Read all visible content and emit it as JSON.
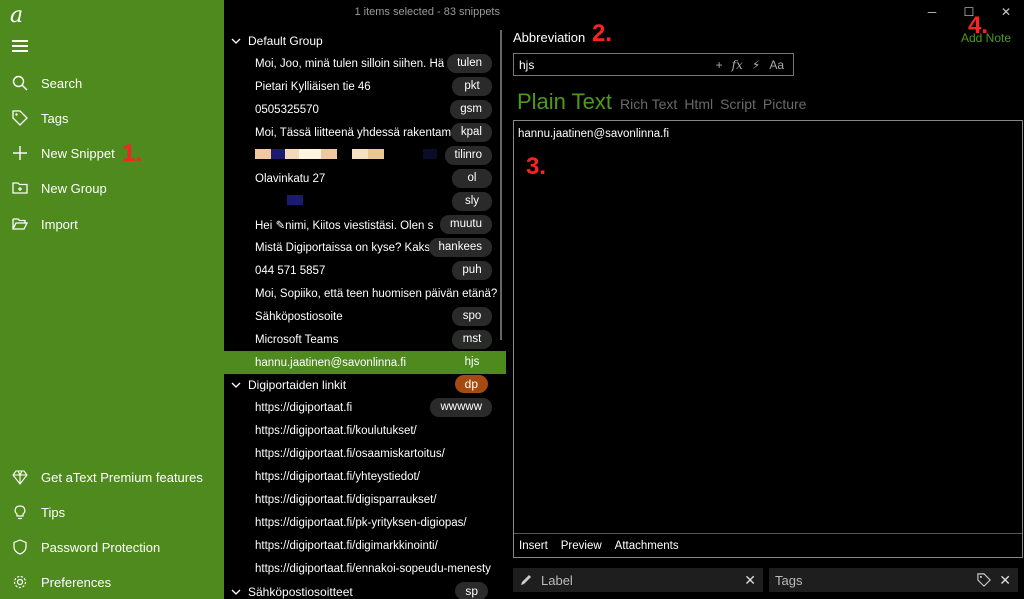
{
  "app": {
    "logo": "a"
  },
  "sidebar": {
    "items": [
      {
        "label": "Search",
        "icon": "search-icon"
      },
      {
        "label": "Tags",
        "icon": "tag-icon"
      },
      {
        "label": "New Snippet",
        "icon": "plus-icon"
      },
      {
        "label": "New Group",
        "icon": "new-folder-icon"
      },
      {
        "label": "Import",
        "icon": "open-folder-icon"
      }
    ],
    "bottom_items": [
      {
        "label": "Get aText Premium features",
        "icon": "diamond-icon"
      },
      {
        "label": "Tips",
        "icon": "lightbulb-icon"
      },
      {
        "label": "Password Protection",
        "icon": "shield-icon"
      },
      {
        "label": "Preferences",
        "icon": "gear-icon"
      }
    ]
  },
  "markers": [
    "1.",
    "2.",
    "3.",
    "4."
  ],
  "list": {
    "header": "1 items selected - 83 snippets",
    "groups": [
      {
        "name": "Default Group",
        "abbr": "",
        "snippets": [
          {
            "text": "Moi,  Joo, minä tulen silloin siihen.  Hä",
            "abbr": "tulen"
          },
          {
            "text": "Pietari Kylliäisen tie 46",
            "abbr": "pkt"
          },
          {
            "text": "0505325570",
            "abbr": "gsm"
          },
          {
            "text": "Moi,  Tässä liitteenä yhdessä rakentama",
            "abbr": "kpal"
          },
          {
            "text": "",
            "abbr": "tilinro"
          },
          {
            "text": "Olavinkatu 27",
            "abbr": "ol"
          },
          {
            "text": "",
            "abbr": "sly"
          },
          {
            "text": "Hei  ✎nimi,  Kiitos viestistäsi. Olen s",
            "abbr": "muutu"
          },
          {
            "text": "Mistä Digiportaissa on kyse?  Kaksi",
            "abbr": "hankees"
          },
          {
            "text": "044 571 5857",
            "abbr": "puh"
          },
          {
            "text": "Moi,  Sopiiko, että teen huomisen päivän etänä?",
            "abbr": ""
          },
          {
            "text": "Sähköpostiosoite",
            "abbr": "spo"
          },
          {
            "text": "Microsoft Teams",
            "abbr": "mst"
          },
          {
            "text": "hannu.jaatinen@savonlinna.fi",
            "abbr": "hjs"
          }
        ]
      },
      {
        "name": "Digiportaiden linkit",
        "abbr": "dp",
        "snippets": [
          {
            "text": "https://digiportaat.fi",
            "abbr": "wwwww"
          },
          {
            "text": "https://digiportaat.fi/koulutukset/",
            "abbr": ""
          },
          {
            "text": "https://digiportaat.fi/osaamiskartoitus/",
            "abbr": ""
          },
          {
            "text": "https://digiportaat.fi/yhteystiedot/",
            "abbr": ""
          },
          {
            "text": "https://digiportaat.fi/digisparraukset/",
            "abbr": ""
          },
          {
            "text": "https://digiportaat.fi/pk-yrityksen-digiopas/",
            "abbr": ""
          },
          {
            "text": "https://digiportaat.fi/digimarkkinointi/",
            "abbr": ""
          },
          {
            "text": "https://digiportaat.fi/ennakoi-sopeudu-menesty",
            "abbr": ""
          }
        ]
      },
      {
        "name": "Sähköpostiosoitteet",
        "abbr": "sp",
        "snippets": []
      }
    ]
  },
  "editor": {
    "abbreviation_label": "Abbreviation",
    "add_note": "Add Note",
    "abbreviation_value": "hjs",
    "tabs": [
      "Plain Text",
      "Rich Text",
      "Html",
      "Script",
      "Picture"
    ],
    "active_tab": "Plain Text",
    "content": "hannu.jaatinen@savonlinna.fi",
    "footer_buttons": [
      "Insert",
      "Preview",
      "Attachments"
    ],
    "label_placeholder": "Label",
    "tags_placeholder": "Tags",
    "abbr_tools": [
      "+",
      "fx",
      "⚡",
      "Aa"
    ]
  },
  "colors": {
    "accent": "#4e8a1d",
    "group_badge": "#a54a10",
    "marker": "#ff2020"
  }
}
